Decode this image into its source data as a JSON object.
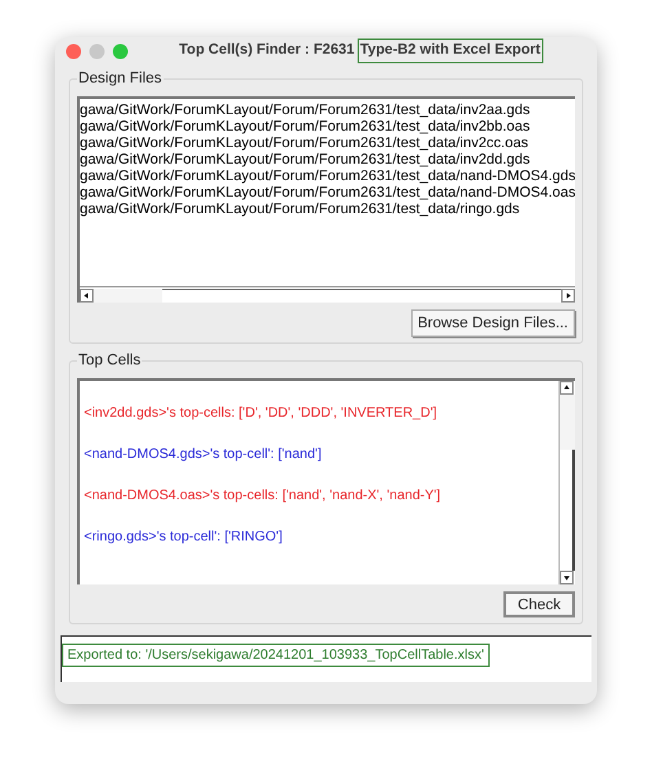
{
  "window": {
    "title": "Top Cell(s) Finder : F2631",
    "title_highlight": "Type-B2 with Excel Export"
  },
  "design_files": {
    "label": "Design Files",
    "files": [
      "gawa/GitWork/ForumKLayout/Forum/Forum2631/test_data/inv2aa.gds",
      "gawa/GitWork/ForumKLayout/Forum/Forum2631/test_data/inv2bb.oas",
      "gawa/GitWork/ForumKLayout/Forum/Forum2631/test_data/inv2cc.oas",
      "gawa/GitWork/ForumKLayout/Forum/Forum2631/test_data/inv2dd.gds",
      "gawa/GitWork/ForumKLayout/Forum/Forum2631/test_data/nand-DMOS4.gds",
      "gawa/GitWork/ForumKLayout/Forum/Forum2631/test_data/nand-DMOS4.oas",
      "gawa/GitWork/ForumKLayout/Forum/Forum2631/test_data/ringo.gds"
    ],
    "button": "Browse Design Files..."
  },
  "top_cells": {
    "label": "Top Cells",
    "lines": [
      {
        "text": "<inv2dd.gds>'s top-cells: ['D', 'DD', 'DDD', 'INVERTER_D']",
        "color": "#e8262b"
      },
      {
        "text": "<nand-DMOS4.gds>'s top-cell': ['nand']",
        "color": "#2a2ad8"
      },
      {
        "text": "<nand-DMOS4.oas>'s top-cells: ['nand', 'nand-X', 'nand-Y']",
        "color": "#e8262b"
      },
      {
        "text": "<ringo.gds>'s top-cell': ['RINGO']",
        "color": "#2a2ad8"
      }
    ],
    "button": "Check"
  },
  "status": {
    "text": "Exported to: '/Users/sekigawa/20241201_103933_TopCellTable.xlsx'"
  }
}
